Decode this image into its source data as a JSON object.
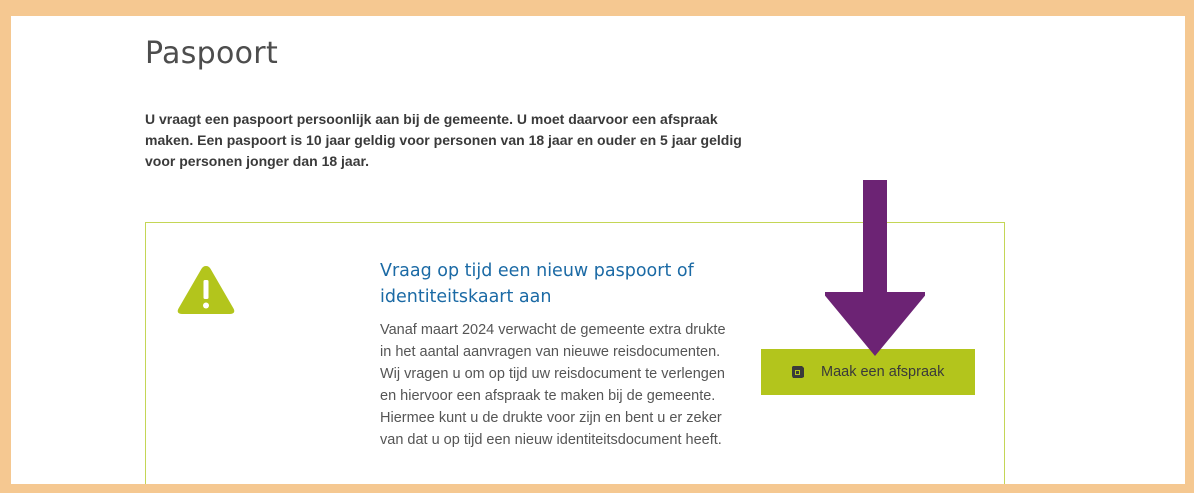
{
  "page": {
    "title": "Paspoort",
    "intro": "U vraagt een paspoort persoonlijk aan bij de gemeente. U moet daarvoor een afspraak maken. Een paspoort is 10 jaar geldig voor personen van 18 jaar en ouder en 5 jaar geldig voor personen jonger dan 18 jaar."
  },
  "notice": {
    "icon": "warning-icon",
    "title": "Vraag op tijd een nieuw paspoort of identiteitskaart aan",
    "body": "Vanaf maart 2024 verwacht de gemeente extra drukte in het aantal aanvragen van nieuwe reisdocumenten. Wij vragen u om op tijd uw reisdocument te verlengen en hiervoor een afspraak te maken bij de gemeente. Hiermee kunt u de drukte voor zijn en bent u er zeker van dat u op tijd een nieuw identiteitsdocument heeft.",
    "button_label": "Maak een afspraak",
    "button_icon": "calendar-icon"
  },
  "annotation": {
    "arrow_icon": "arrow-down-icon"
  },
  "colors": {
    "frame": "#f5c891",
    "accent_green": "#b3c51c",
    "title_blue": "#1b6aa5",
    "arrow_purple": "#6c2374"
  }
}
